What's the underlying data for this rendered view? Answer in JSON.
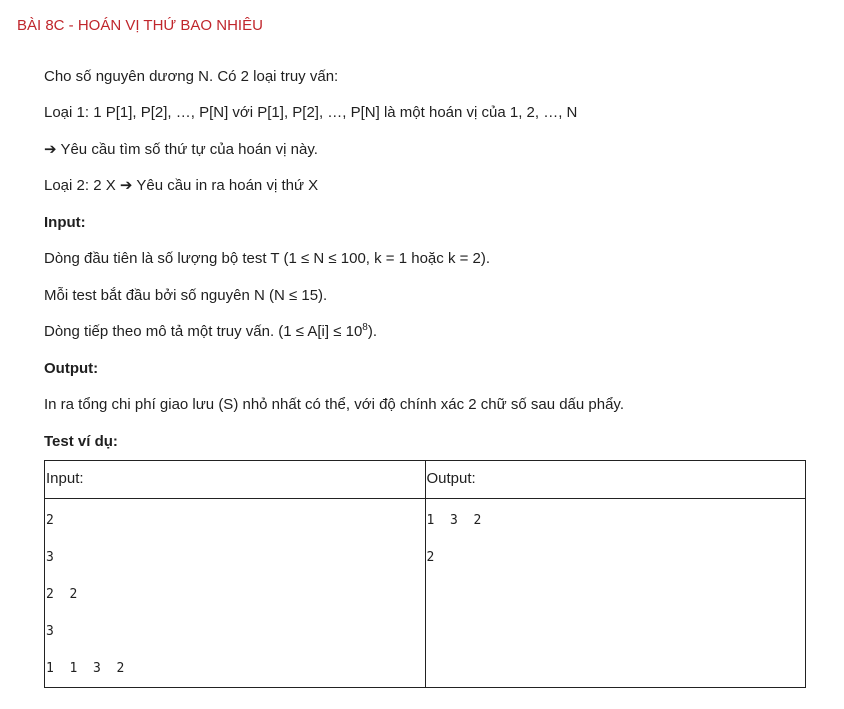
{
  "title": "BÀI 8C - HOÁN VỊ THỨ BAO NHIÊU",
  "paragraphs": {
    "intro": "Cho số nguyên dương N. Có 2 loại truy vấn:",
    "type1": "Loại 1: 1 P[1], P[2], …, P[N] với P[1], P[2], …, P[N] là một hoán vị của 1, 2, …, N",
    "type1_req": "➔ Yêu cầu tìm số thứ tự của hoán vị này.",
    "type2": "Loại 2: 2 X ➔ Yêu cầu in ra hoán vị thứ X",
    "input_heading": "Input:",
    "input1": "Dòng đầu tiên là số lượng bộ test T (1 ≤ N ≤ 100, k = 1 hoặc k = 2).",
    "input2": "Mỗi test bắt đầu bởi số nguyên N (N ≤ 15).",
    "input3_pre": "Dòng tiếp theo mô tả một truy vấn. (1 ≤ A[i] ≤ 10",
    "input3_sup": "8",
    "input3_post": ").",
    "output_heading": "Output:",
    "output1": "In ra tổng chi phí giao lưu (S) nhỏ nhất có thể, với độ chính xác 2 chữ số sau dấu phẩy.",
    "test_heading": "Test ví dụ:"
  },
  "table": {
    "input_header": "Input:",
    "output_header": "Output:",
    "input_lines": [
      "2",
      "3",
      "2 2",
      "3",
      "1 1 3 2"
    ],
    "output_lines": [
      "1 3 2",
      "2"
    ]
  }
}
